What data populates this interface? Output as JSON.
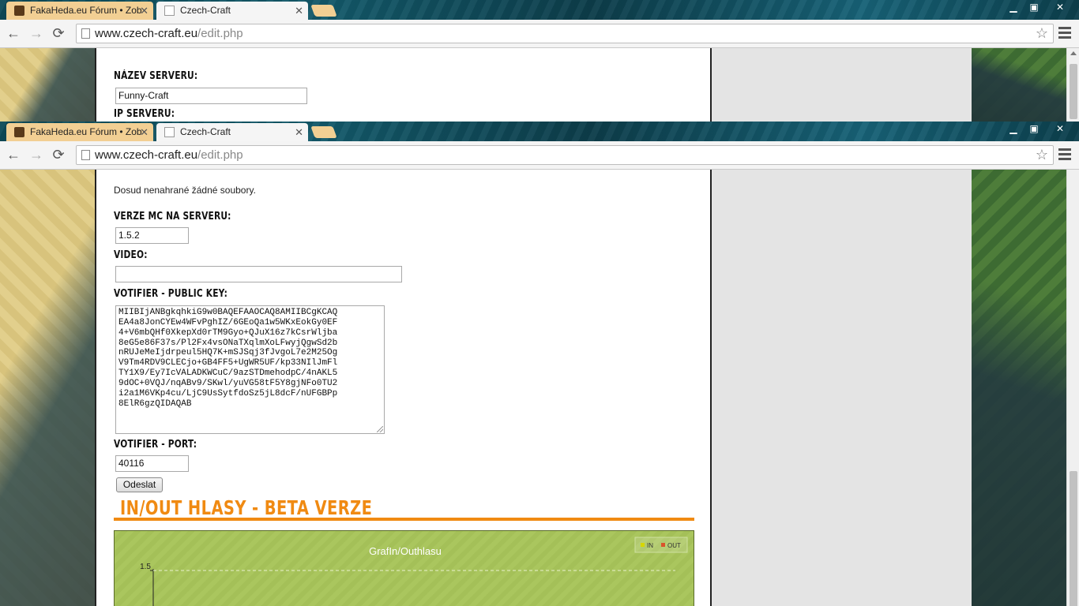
{
  "tabs": [
    {
      "title": "FakaHeda.eu Fórum • Zob",
      "active": false
    },
    {
      "title": "Czech-Craft",
      "active": true
    }
  ],
  "address": {
    "host": "www.czech-craft.eu",
    "path": "/edit.php"
  },
  "window_controls": {
    "minimize": "▁",
    "maximize": "▣",
    "close": "✕"
  },
  "top_form": {
    "server_name_label": "Název serveru:",
    "server_name_value": "Funny-Craft",
    "server_ip_label": "IP serveru:"
  },
  "form": {
    "files_info": "Dosud nenahrané žádné soubory.",
    "mc_version_label": "Verze MC na serveru:",
    "mc_version_value": "1.5.2",
    "video_label": "Video:",
    "video_value": "",
    "votifier_key_label": "Votifier - Public key:",
    "votifier_key_lines": [
      "MIIBIjANBgkqhkiG9w0BAQEFAAOCAQ8AMIIBCgKCAQ",
      "EA4a8JonCYEw4WFvPghIZ/6GEoQa1w5WKxEokGy0EF",
      "4+V6mbQHf0XkepXd0rTM9Gyo+QJuX16z7kCsrWljba",
      "8eG5e86F37s/Pl2Fx4vsONaTXqlmXoLFwyjQgwSd2b",
      "nRUJeMeIjdrpeul5HQ7K+mSJSqj3fJvgoL7e2M25Og",
      "V9Tm4RDV9CLECjo+GB4FF5+UgWR5UF/kp33NIlJmFl",
      "TY1X9/Ey7IcVALADKWCuC/9azSTDmehodpC/4nAKL5",
      "9dOC+0VQJ/nqABv9/SKwl/yuVG58tF5Y8gjNFo0TU2",
      "i2a1M6VKp4cu/LjC9UsSytfdoSz5jL8dcF/nUFGBPp",
      "8ElR6gzQIDAQAB"
    ],
    "votifier_port_label": "Votifier - port:",
    "votifier_port_value": "40116",
    "submit_label": "Odeslat"
  },
  "section": {
    "title": "In/Out hlasy - Beta verze"
  },
  "chart_data": {
    "type": "bar",
    "title": "GrafIn/Outhlasu",
    "legend": [
      "IN",
      "OUT"
    ],
    "legend_placement": "top-right",
    "series_colors": {
      "IN": "#d6d600",
      "OUT": "#d9542c"
    },
    "y_tick_labels": [
      "1.5"
    ],
    "ylim_top": 1.5,
    "grid": true
  },
  "colors": {
    "accent": "#f08a12",
    "chart_bg": "#aac65e"
  }
}
